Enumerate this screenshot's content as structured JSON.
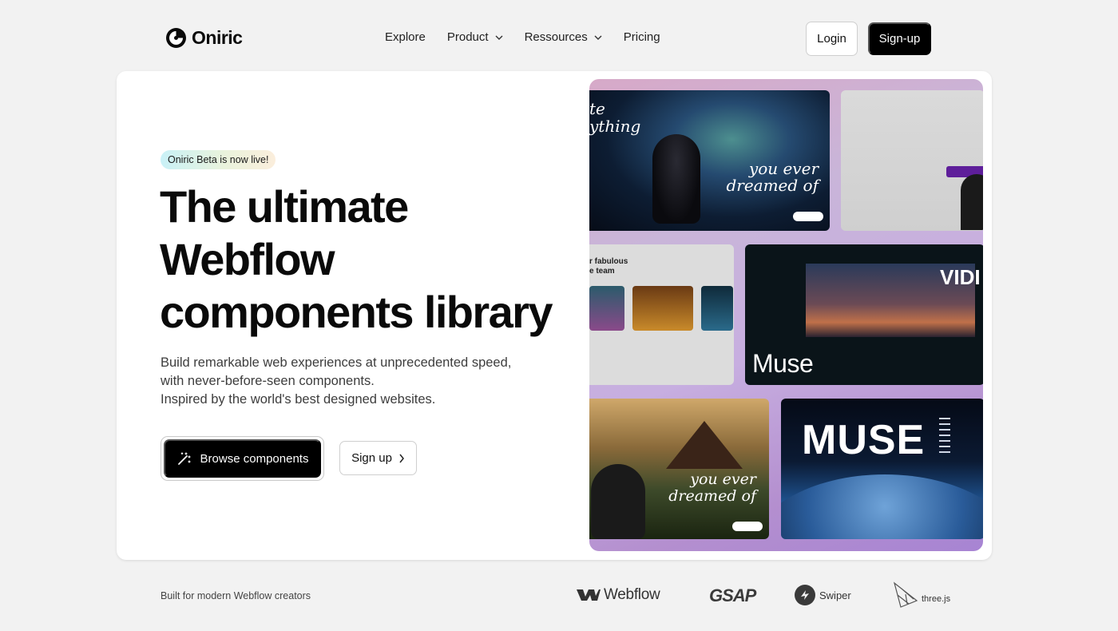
{
  "nav": {
    "brand": "Oniric",
    "menu": [
      {
        "label": "Explore",
        "has_dropdown": false
      },
      {
        "label": "Product",
        "has_dropdown": true
      },
      {
        "label": "Ressources",
        "has_dropdown": true
      },
      {
        "label": "Pricing",
        "has_dropdown": false
      }
    ],
    "login_label": "Login",
    "signup_label": "Sign-up"
  },
  "hero": {
    "badge": "Oniric Beta is now live!",
    "headline": [
      "The ultimate",
      "Webflow",
      "components library"
    ],
    "subtext": [
      "Build remarkable web experiences at unprecedented speed,",
      "with never-before-seen components.",
      "Inspired by the world's best designed websites."
    ],
    "primary_cta": "Browse components",
    "secondary_cta": "Sign up"
  },
  "preview": {
    "tile1_left": [
      "te",
      "ything"
    ],
    "tile1_text": [
      "you ever",
      "dreamed of"
    ],
    "tile3_header": [
      "r fabulous",
      "e team"
    ],
    "tile4_title": "Muse",
    "tile4_corner": "VIDI",
    "tile5_text": [
      "you ever",
      "dreamed of"
    ],
    "tile6_title": "MUSE"
  },
  "footer": {
    "tagline": "Built for modern Webflow creators",
    "partners": [
      "Webflow",
      "GSAP",
      "Swiper",
      "three.js"
    ]
  },
  "colors": {
    "background": "#f2f2f2",
    "card": "#ffffff",
    "primary": "#000000",
    "badge_gradient": [
      "#c9f1f7",
      "#fbeedc"
    ]
  },
  "icons": [
    "oniric-logo-icon",
    "chevron-down-icon",
    "magic-wand-icon",
    "chevron-right-icon",
    "webflow-logo-icon",
    "swiper-logo-icon",
    "threejs-logo-icon"
  ]
}
